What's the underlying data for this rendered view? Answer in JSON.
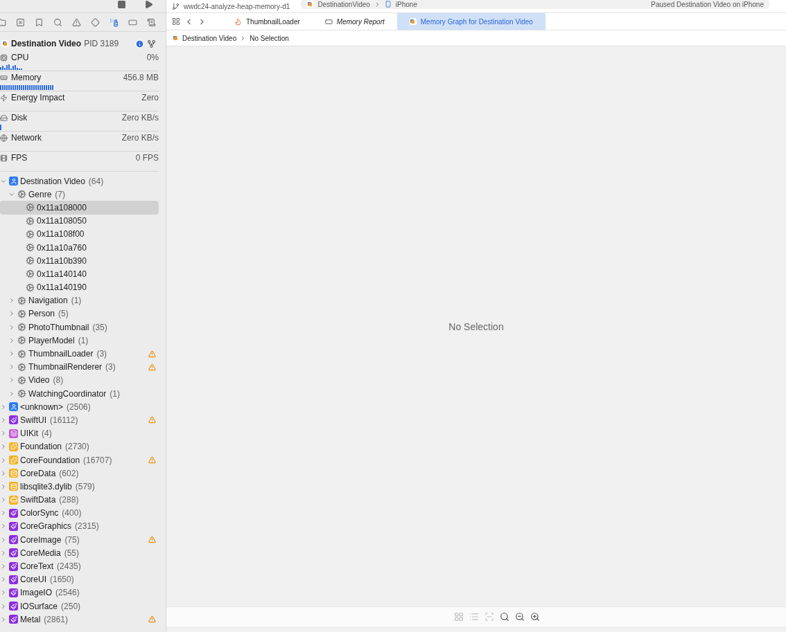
{
  "toolbar": {
    "branch": "wwdc24-analyze-heap-memory-d1",
    "scheme": "DestinationVideo",
    "device": "iPhone",
    "status": "Paused Destination Video on iPhone"
  },
  "navigator_tabs": [
    {
      "kind": "folder",
      "selected": false
    },
    {
      "kind": "source",
      "selected": false
    },
    {
      "kind": "bookmark",
      "selected": false
    },
    {
      "kind": "search",
      "selected": false
    },
    {
      "kind": "issue",
      "selected": false
    },
    {
      "kind": "test",
      "selected": false
    },
    {
      "kind": "debug",
      "selected": true
    },
    {
      "kind": "breakpoint",
      "selected": false
    },
    {
      "kind": "report",
      "selected": false
    }
  ],
  "process": {
    "name": "Destination Video",
    "pid": "PID 3189"
  },
  "gauges": [
    {
      "kind": "cpu",
      "label": "CPU",
      "reading": "0%"
    },
    {
      "kind": "memory",
      "label": "Memory",
      "reading": "456.8 MB"
    },
    {
      "kind": "energy",
      "label": "Energy Impact",
      "reading": "Zero"
    },
    {
      "kind": "disk",
      "label": "Disk",
      "reading": "Zero KB/s"
    },
    {
      "kind": "network",
      "label": "Network",
      "reading": "Zero KB/s"
    },
    {
      "kind": "fps",
      "label": "FPS",
      "reading": "0 FPS"
    }
  ],
  "tree": [
    {
      "kind": "person",
      "name": "Destination Video",
      "count": "(64)",
      "expanded": true,
      "selected": false,
      "warning": false,
      "children": [
        {
          "kind": "object",
          "name": "Genre",
          "count": "(7)",
          "expanded": true,
          "selected": false,
          "warning": false,
          "children": [
            {
              "kind": "instance",
              "name": "0x11a108000",
              "selected": true,
              "warning": false
            },
            {
              "kind": "instance",
              "name": "0x11a108050",
              "selected": false,
              "warning": false
            },
            {
              "kind": "instance",
              "name": "0x11a108f00",
              "selected": false,
              "warning": false
            },
            {
              "kind": "instance",
              "name": "0x11a10a760",
              "selected": false,
              "warning": false
            },
            {
              "kind": "instance",
              "name": "0x11a10b390",
              "selected": false,
              "warning": false
            },
            {
              "kind": "instance",
              "name": "0x11a140140",
              "selected": false,
              "warning": false
            },
            {
              "kind": "instance",
              "name": "0x11a140190",
              "selected": false,
              "warning": false
            }
          ]
        },
        {
          "kind": "object",
          "name": "Navigation",
          "count": "(1)",
          "expanded": false,
          "selected": false,
          "warning": false
        },
        {
          "kind": "object",
          "name": "Person",
          "count": "(5)",
          "expanded": false,
          "selected": false,
          "warning": false
        },
        {
          "kind": "object",
          "name": "PhotoThumbnail",
          "count": "(35)",
          "expanded": false,
          "selected": false,
          "warning": false
        },
        {
          "kind": "object",
          "name": "PlayerModel",
          "count": "(1)",
          "expanded": false,
          "selected": false,
          "warning": false
        },
        {
          "kind": "object",
          "name": "ThumbnailLoader",
          "count": "(3)",
          "expanded": false,
          "selected": false,
          "warning": true
        },
        {
          "kind": "object",
          "name": "ThumbnailRenderer",
          "count": "(3)",
          "expanded": false,
          "selected": false,
          "warning": true
        },
        {
          "kind": "object",
          "name": "Video",
          "count": "(8)",
          "expanded": false,
          "selected": false,
          "warning": false
        },
        {
          "kind": "object",
          "name": "WatchingCoordinator",
          "count": "(1)",
          "expanded": false,
          "selected": false,
          "warning": false
        }
      ]
    },
    {
      "kind": "person",
      "name": "<unknown>",
      "count": "(2506)",
      "expanded": false,
      "selected": false,
      "warning": false
    },
    {
      "kind": "brush",
      "name": "SwiftUI",
      "count": "(16112)",
      "expanded": false,
      "selected": false,
      "warning": true
    },
    {
      "kind": "stack",
      "name": "UIKit",
      "count": "(4)",
      "expanded": false,
      "selected": false,
      "warning": false
    },
    {
      "kind": "puzzle",
      "name": "Foundation",
      "count": "(2730)",
      "expanded": false,
      "selected": false,
      "warning": false
    },
    {
      "kind": "puzzle",
      "name": "CoreFoundation",
      "count": "(16707)",
      "expanded": false,
      "selected": false,
      "warning": true
    },
    {
      "kind": "database",
      "name": "CoreData",
      "count": "(602)",
      "expanded": false,
      "selected": false,
      "warning": false
    },
    {
      "kind": "database",
      "name": "libsqlite3.dylib",
      "count": "(579)",
      "expanded": false,
      "selected": false,
      "warning": false
    },
    {
      "kind": "toolbox",
      "name": "SwiftData",
      "count": "(288)",
      "expanded": false,
      "selected": false,
      "warning": false
    },
    {
      "kind": "brush",
      "name": "ColorSync",
      "count": "(400)",
      "expanded": false,
      "selected": false,
      "warning": false
    },
    {
      "kind": "brush",
      "name": "CoreGraphics",
      "count": "(2315)",
      "expanded": false,
      "selected": false,
      "warning": false
    },
    {
      "kind": "brush",
      "name": "CoreImage",
      "count": "(75)",
      "expanded": false,
      "selected": false,
      "warning": true
    },
    {
      "kind": "brush",
      "name": "CoreMedia",
      "count": "(55)",
      "expanded": false,
      "selected": false,
      "warning": false
    },
    {
      "kind": "brush",
      "name": "CoreText",
      "count": "(2435)",
      "expanded": false,
      "selected": false,
      "warning": false
    },
    {
      "kind": "brush",
      "name": "CoreUI",
      "count": "(1650)",
      "expanded": false,
      "selected": false,
      "warning": false
    },
    {
      "kind": "brush",
      "name": "ImageIO",
      "count": "(2546)",
      "expanded": false,
      "selected": false,
      "warning": false
    },
    {
      "kind": "brush",
      "name": "IOSurface",
      "count": "(250)",
      "expanded": false,
      "selected": false,
      "warning": false
    },
    {
      "kind": "brush",
      "name": "Metal",
      "count": "(2861)",
      "expanded": false,
      "selected": false,
      "warning": true
    }
  ],
  "editor_tabs": [
    {
      "kind": "swift",
      "label": "ThumbnailLoader",
      "selected": false,
      "preview": false
    },
    {
      "kind": "report",
      "label": "Memory Report",
      "selected": false,
      "preview": true
    },
    {
      "kind": "graph",
      "label": "Memory Graph for Destination Video",
      "selected": true,
      "preview": false
    }
  ],
  "jump_bar": [
    "Destination Video",
    "No Selection"
  ],
  "canvas": {
    "message": "No Selection"
  },
  "bottom_tools": [
    {
      "kind": "layout",
      "disabled": true
    },
    {
      "kind": "list",
      "disabled": true
    },
    {
      "kind": "focus",
      "disabled": true
    },
    {
      "kind": "zoom-fit",
      "disabled": false
    },
    {
      "kind": "zoom-out",
      "disabled": false
    },
    {
      "kind": "zoom-in",
      "disabled": false
    }
  ]
}
